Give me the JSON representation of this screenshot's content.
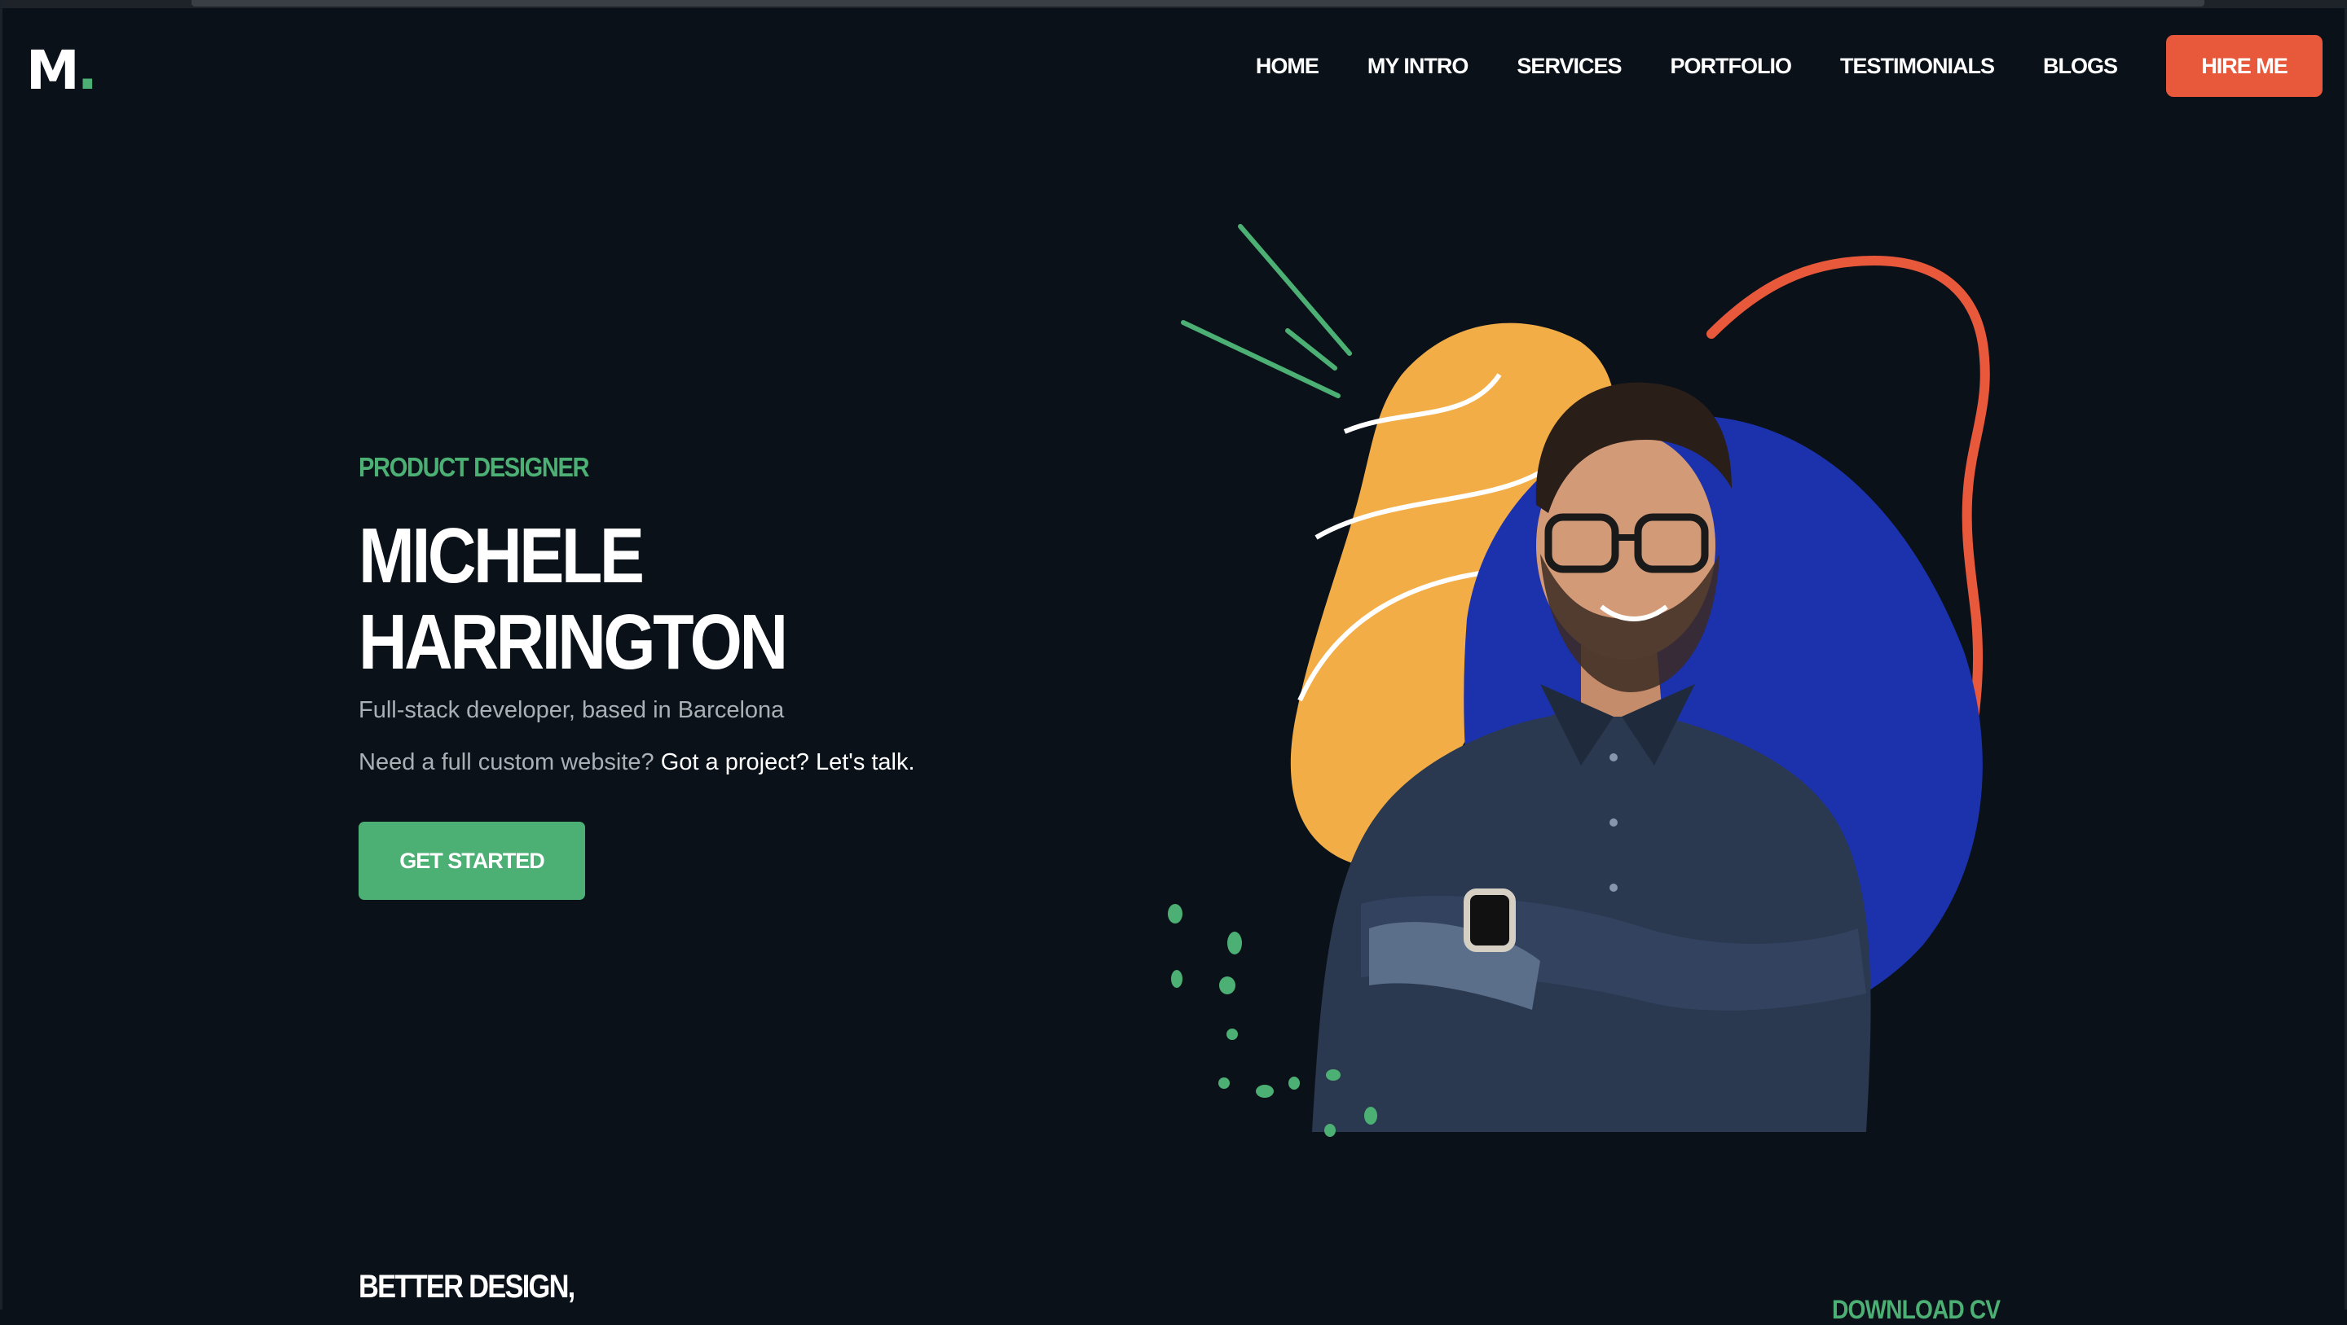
{
  "header": {
    "logo_text": "M",
    "logo_dot": ".",
    "nav": [
      {
        "label": "HOME"
      },
      {
        "label": "MY INTRO"
      },
      {
        "label": "SERVICES"
      },
      {
        "label": "PORTFOLIO"
      },
      {
        "label": "TESTIMONIALS"
      },
      {
        "label": "BLOGS"
      }
    ],
    "hire_label": "HIRE ME"
  },
  "hero": {
    "role": "PRODUCT DESIGNER",
    "name_line1": "MICHELE",
    "name_line2": "HARRINGTON",
    "tagline": "Full-stack developer, based in Barcelona",
    "cta_prefix": "Need a full custom website?",
    "cta_link": "Got a project? Let's talk.",
    "button_label": "GET STARTED"
  },
  "next_section": {
    "heading": "BETTER DESIGN,",
    "download_label": "DOWNLOAD CV"
  },
  "colors": {
    "background": "#0a1119",
    "accent_green": "#4caf73",
    "accent_orange": "#e8583a",
    "blob_yellow": "#f2ad47",
    "blob_blue": "#1c32ad"
  },
  "icons": {
    "portrait": "person-portrait-illustration"
  }
}
